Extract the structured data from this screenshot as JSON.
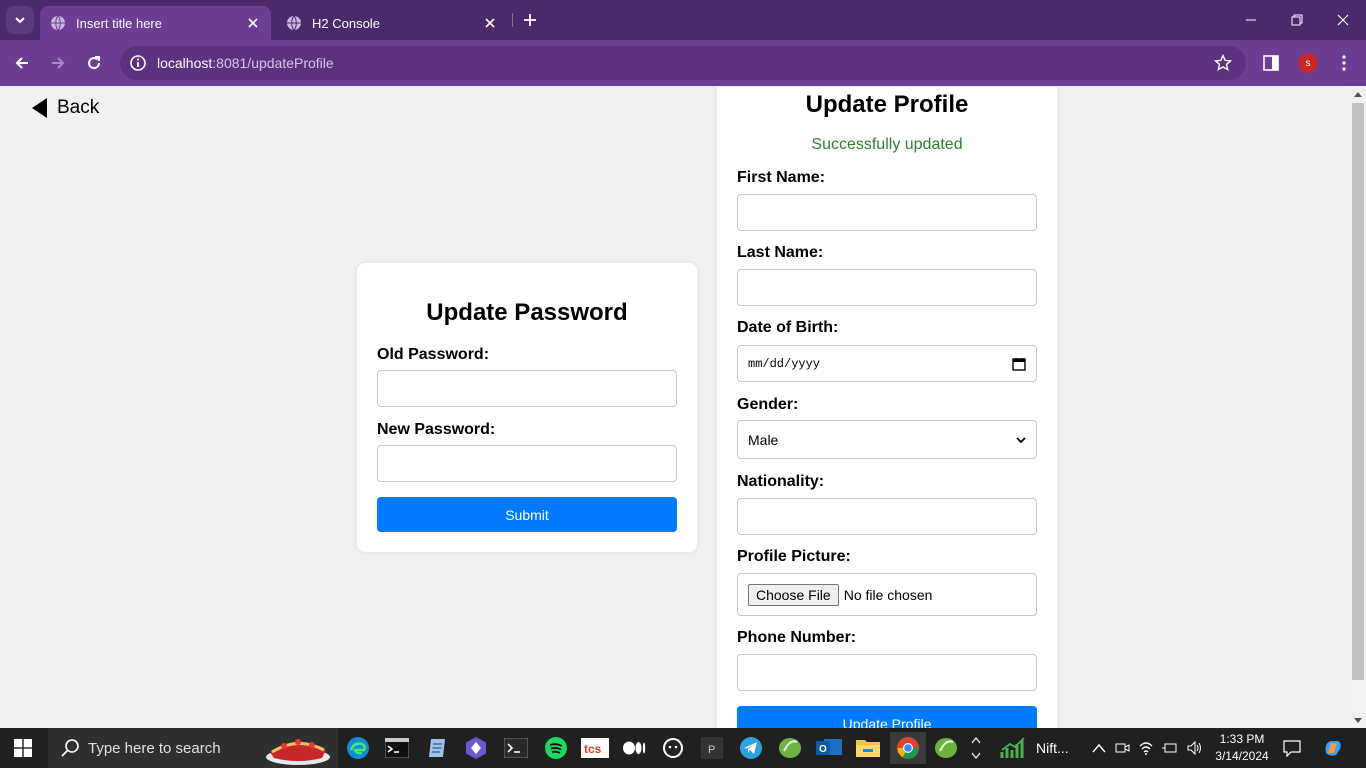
{
  "browser": {
    "tabs": [
      {
        "label": "Insert title here",
        "active": true
      },
      {
        "label": "H2 Console",
        "active": false
      }
    ],
    "url": {
      "host": "localhost",
      "rest": ":8081/updateProfile"
    },
    "profile_initial": "s",
    "accent": "#6b3e94"
  },
  "page": {
    "back_label": "Back",
    "password_form": {
      "title": "Update Password",
      "old_label": "Old Password:",
      "new_label": "New Password:",
      "submit_label": "Submit"
    },
    "profile_form": {
      "title": "Update Profile",
      "status": "Successfully updated",
      "first_name_label": "First Name:",
      "last_name_label": "Last Name:",
      "dob_label": "Date of Birth:",
      "dob_placeholder": "mm/dd/yyyy",
      "gender_label": "Gender:",
      "gender_value": "Male",
      "nationality_label": "Nationality:",
      "picture_label": "Profile Picture:",
      "choose_file_label": "Choose File",
      "no_file_label": "No file chosen",
      "phone_label": "Phone Number:",
      "submit_label": "Update Profile"
    },
    "button_color": "#007bff",
    "status_color": "#2e7d32"
  },
  "taskbar": {
    "search_placeholder": "Type here to search",
    "tray_app_label": "Nift...",
    "time": "1:33 PM",
    "date": "3/14/2024"
  }
}
